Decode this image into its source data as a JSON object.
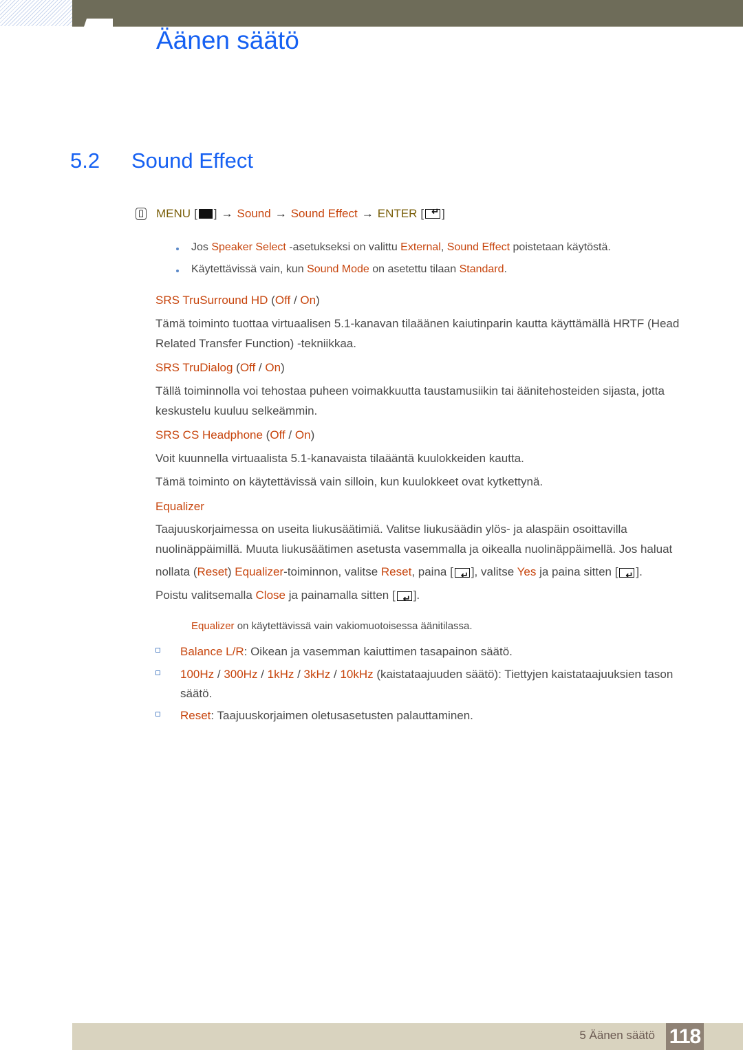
{
  "chapter_title": "Äänen säätö",
  "section": {
    "number": "5.2",
    "title": "Sound Effect"
  },
  "menu_path": {
    "menu": "MENU",
    "items": [
      "Sound",
      "Sound Effect"
    ],
    "enter": "ENTER",
    "arrow": "→"
  },
  "notes": [
    {
      "parts": [
        {
          "t": "Jos ",
          "c": ""
        },
        {
          "t": "Speaker Select",
          "c": "o"
        },
        {
          "t": " -asetukseksi on valittu ",
          "c": ""
        },
        {
          "t": "External",
          "c": "o"
        },
        {
          "t": ", ",
          "c": ""
        },
        {
          "t": "Sound Effect",
          "c": "o"
        },
        {
          "t": " poistetaan käytöstä.",
          "c": ""
        }
      ]
    },
    {
      "parts": [
        {
          "t": "Käytettävissä vain, kun ",
          "c": ""
        },
        {
          "t": "Sound Mode",
          "c": "o"
        },
        {
          "t": " on asetettu tilaan ",
          "c": ""
        },
        {
          "t": "Standard",
          "c": "o"
        },
        {
          "t": ".",
          "c": ""
        }
      ]
    }
  ],
  "options": [
    {
      "name": "SRS TruSurround HD",
      "values": [
        "Off",
        "On"
      ],
      "paragraphs": [
        "Tämä toiminto tuottaa virtuaalisen 5.1-kanavan tilaäänen kaiutinparin kautta käyttämällä HRTF (Head Related Transfer Function) -tekniikkaa."
      ]
    },
    {
      "name": "SRS TruDialog",
      "values": [
        "Off",
        "On"
      ],
      "paragraphs": [
        "Tällä toiminnolla voi tehostaa puheen voimakkuutta taustamusiikin tai äänitehosteiden sijasta, jotta keskustelu kuuluu selkeämmin."
      ]
    },
    {
      "name": "SRS CS Headphone",
      "values": [
        "Off",
        "On"
      ],
      "paragraphs": [
        "Voit kuunnella virtuaalista 5.1-kanavaista tilaääntä kuulokkeiden kautta.",
        "Tämä toiminto on käytettävissä vain silloin, kun kuulokkeet ovat kytkettynä."
      ]
    }
  ],
  "equalizer": {
    "name": "Equalizer",
    "para1": "Taajuuskorjaimessa on useita liukusäätimiä. Valitse liukusäädin ylös- ja alaspäin osoittavilla nuolinäppäimillä. Muuta liukusäätimen asetusta vasemmalla ja oikealla nuolinäppäimellä. Jos haluat",
    "line3": {
      "a": "nollata (",
      "reset1": "Reset",
      "b": ") ",
      "eq": "Equalizer",
      "c": "-toiminnon, valitse ",
      "reset2": "Reset",
      "d": ", paina [",
      "e": "], valitse ",
      "yes": "Yes",
      "f": " ja paina sitten [",
      "g": "]."
    },
    "line4": {
      "a": "Poistu valitsemalla ",
      "close": "Close",
      "b": " ja painamalla sitten [",
      "c": "]."
    },
    "note": {
      "eq": "Equalizer",
      "rest": " on käytettävissä vain vakiomuotoisessa äänitilassa."
    },
    "subitems": [
      {
        "label": "Balance L/R",
        "rest": ": Oikean ja vasemman kaiuttimen tasapainon säätö."
      },
      {
        "bands": [
          "100Hz",
          "300Hz",
          "1kHz",
          "3kHz",
          "10kHz"
        ],
        "rest": " (kaistataajuuden säätö): Tiettyjen kaistataajuuksien tason säätö."
      },
      {
        "label": "Reset",
        "rest": ": Taajuuskorjaimen oletusasetusten palauttaminen."
      }
    ]
  },
  "footer": {
    "chapter_label": "5 Äänen säätö",
    "page_number": "118"
  }
}
